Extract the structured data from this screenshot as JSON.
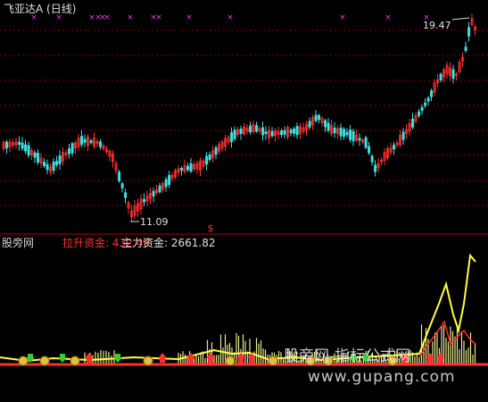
{
  "header": {
    "stock_title": "飞亚达A (日线)"
  },
  "indicator": {
    "name": "股旁网",
    "line1_label": "拉升资金: 432.49",
    "line2_label": "主力资金: 2661.82"
  },
  "price_chart": {
    "high_label": "19.47",
    "low_label": "11.09",
    "signal_marker": "$"
  },
  "watermark": {
    "line1": "股旁网-指标公式网",
    "line2": "www.gupang.com"
  },
  "colors": {
    "background": "#000000",
    "up_candle": "#ff3030",
    "down_candle": "#40e0e0",
    "grid": "#8b0000",
    "marker": "#e040e0",
    "yellow_line": "#ffff40",
    "bars": "#e8e890"
  }
}
